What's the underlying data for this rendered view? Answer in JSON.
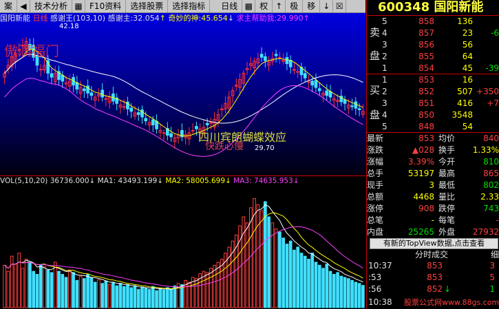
{
  "toolbar": {
    "items": [
      "案",
      "技术分析",
      "F10资料",
      "选择股票",
      "选择指标",
      "日线",
      "权",
      "极",
      "移"
    ],
    "icons": [
      "back-icon",
      "chart-icon",
      "arrow-up-icon",
      "arrow-down-icon",
      "grid-icon",
      "checkbox-icon"
    ],
    "icon_glyphs": [
      "◀",
      "▦",
      "↑",
      "↓",
      "▩",
      "☒"
    ]
  },
  "chart_header": {
    "stock_name": "国阳新能",
    "period": "日线",
    "indicator_name": "感谢王(103,10)",
    "ind1_label": "感谢主:",
    "ind1_value": "32.054",
    "ind1_arrow": "↑",
    "ind2_label": "奇妙的神:",
    "ind2_value": "45.654",
    "ind2_arrow": "↓",
    "ind3_label": "求主帮助我:",
    "ind3_value": "29.990",
    "ind3_arrow": "↑"
  },
  "annotations": {
    "peak_price": "42.18",
    "low_price": "29.70",
    "overlay_top_left": "傲满福门",
    "overlay_mid": "四川宾朗蝴蝶效应",
    "overlay_mid2": "快跌心慢"
  },
  "volume_header": {
    "label": "VOL(5,10,20)",
    "vol_value": "36736.000",
    "vol_arrow": "↓",
    "ma1": "MA1: 43493.199",
    "ma1_arrow": "↓",
    "ma2": "MA2: 58005.699",
    "ma2_arrow": "↓",
    "ma3": "MA3: 74635.953",
    "ma3_arrow": "↓"
  },
  "chart_data": [
    {
      "type": "candlestick",
      "title": "",
      "x": [
        "1",
        "2",
        "3",
        "4",
        "5",
        "6",
        "7",
        "8",
        "9",
        "10",
        "11",
        "12",
        "13",
        "14",
        "15",
        "16",
        "17",
        "18",
        "19",
        "20",
        "21",
        "22",
        "23",
        "24",
        "25",
        "26",
        "27",
        "28",
        "29",
        "30",
        "31",
        "32",
        "33",
        "34",
        "35",
        "36",
        "37",
        "38",
        "39",
        "40",
        "41",
        "42",
        "43",
        "44",
        "45",
        "46",
        "47",
        "48",
        "49",
        "50",
        "51",
        "52",
        "53",
        "54",
        "55",
        "56",
        "57",
        "58",
        "59",
        "60",
        "61",
        "62",
        "63",
        "64",
        "65",
        "66",
        "67",
        "68",
        "69",
        "70",
        "71",
        "72",
        "73",
        "74",
        "75",
        "76",
        "77",
        "78",
        "79",
        "80",
        "81",
        "82",
        "83",
        "84",
        "85",
        "86",
        "87",
        "88",
        "89",
        "90",
        "91",
        "92",
        "93",
        "94",
        "95",
        "96",
        "97",
        "98",
        "99",
        "100"
      ],
      "ylim": [
        26,
        44
      ],
      "close": [
        38,
        39,
        40,
        40.5,
        41,
        41.5,
        42,
        41,
        40,
        39,
        38.5,
        39,
        38,
        37.5,
        38,
        37.2,
        37,
        36.8,
        37,
        36.5,
        36,
        36.2,
        35.8,
        35.5,
        35.2,
        35,
        35.3,
        35,
        34.8,
        35,
        34.5,
        34.2,
        34,
        33.8,
        33.5,
        33.2,
        33,
        32.8,
        32.5,
        32,
        31.8,
        31.5,
        31,
        30.8,
        30.5,
        30.2,
        30,
        29.9,
        30.2,
        30,
        30.3,
        30.5,
        30.8,
        31,
        31,
        31.2,
        31.5,
        31.8,
        32.2,
        32.8,
        33.5,
        34.2,
        35,
        35.8,
        36.5,
        37.2,
        38,
        38.6,
        39.2,
        39.5,
        39.8,
        40,
        39.6,
        39.4,
        39.8,
        40.2,
        40,
        39.6,
        39.2,
        38.8,
        38.5,
        38.2,
        37.8,
        37.4,
        37,
        36.5,
        36.2,
        35.8,
        35.5,
        35.2,
        35,
        34.8,
        34.6,
        34.4,
        34.2,
        34,
        33.8,
        33.6,
        33.4,
        33.2
      ],
      "series": [
        {
          "name": "感谢主",
          "values": "yellow MA line"
        },
        {
          "name": "奇妙的神",
          "values": "white MA line"
        },
        {
          "name": "求主帮助我",
          "values": "magenta MA line"
        }
      ],
      "colors": {
        "up": "#ff3030",
        "down": "#40e0ff",
        "ma_yellow": "#ffff00",
        "ma_white": "#ffffff",
        "ma_magenta": "#ff40ff"
      }
    },
    {
      "type": "bar",
      "title": "",
      "ylim": [
        0,
        200000
      ],
      "values": [
        70000,
        60000,
        85000,
        72000,
        90000,
        65000,
        80000,
        75000,
        60000,
        55000,
        70000,
        68000,
        62000,
        58000,
        75000,
        60000,
        55000,
        50000,
        62000,
        58000,
        45000,
        52000,
        48000,
        55000,
        50000,
        42000,
        46000,
        40000,
        44000,
        38000,
        42000,
        36000,
        40000,
        35000,
        38000,
        33000,
        36000,
        30000,
        34000,
        32000,
        30000,
        35000,
        28000,
        31000,
        29000,
        33000,
        30000,
        36000,
        40000,
        38000,
        45000,
        42000,
        50000,
        48000,
        56000,
        60000,
        58000,
        65000,
        70000,
        75000,
        80000,
        90000,
        100000,
        110000,
        120000,
        135000,
        150000,
        140000,
        165000,
        180000,
        170000,
        160000,
        175000,
        150000,
        140000,
        130000,
        125000,
        115000,
        105000,
        110000,
        95000,
        100000,
        90000,
        85000,
        80000,
        90000,
        75000,
        70000,
        65000,
        72000,
        60000,
        55000,
        58000,
        52000,
        50000,
        48000,
        45000,
        42000,
        40000,
        36736
      ]
    }
  ],
  "panel": {
    "code": "600348",
    "name": "国阳新能",
    "sell_label_1": "卖",
    "sell_label_2": "盘",
    "buy_label_1": "买",
    "buy_label_2": "盘",
    "sells": [
      {
        "lvl": "5",
        "price": "858",
        "vol": "136",
        "chg": ""
      },
      {
        "lvl": "4",
        "price": "857",
        "vol": "23",
        "chg": "-6"
      },
      {
        "lvl": "3",
        "price": "856",
        "vol": "56",
        "chg": ""
      },
      {
        "lvl": "2",
        "price": "855",
        "vol": "64",
        "chg": ""
      },
      {
        "lvl": "1",
        "price": "854",
        "vol": "45",
        "chg": "-39"
      }
    ],
    "buys": [
      {
        "lvl": "1",
        "price": "853",
        "vol": "16",
        "chg": ""
      },
      {
        "lvl": "2",
        "price": "852",
        "vol": "507",
        "chg": "+350"
      },
      {
        "lvl": "3",
        "price": "851",
        "vol": "416",
        "chg": "+7"
      },
      {
        "lvl": "4",
        "price": "850",
        "vol": "3548",
        "chg": ""
      },
      {
        "lvl": "5",
        "price": "848",
        "vol": "54",
        "chg": ""
      }
    ],
    "stats": [
      {
        "l1": "最新",
        "v1": "853",
        "l2": "均价",
        "v2": "840"
      },
      {
        "l1": "涨跌",
        "v1": "▲028",
        "l2": "换手",
        "v2": "1.33%"
      },
      {
        "l1": "涨幅",
        "v1": "3.39%",
        "l2": "今开",
        "v2": "810"
      },
      {
        "l1": "总手",
        "v1": "53197",
        "l2": "最高",
        "v2": "865"
      },
      {
        "l1": "现手",
        "v1": "3",
        "l2": "最低",
        "v2": "802"
      },
      {
        "l1": "总额",
        "v1": "4468",
        "l2": "量比",
        "v2": "2.33"
      },
      {
        "l1": "涨停",
        "v1": "908",
        "l2": "跌停",
        "v2": "743"
      },
      {
        "l1": "总笔",
        "v1": "-",
        "l2": "每笔",
        "v2": "-"
      },
      {
        "l1": "内盘",
        "v1": "25265",
        "l2": "外盘",
        "v2": "27932"
      }
    ],
    "topview_btn": "有新的TopView数据,点击查看",
    "tab_trades": "分时成交",
    "tab_detail": "细",
    "trades": [
      {
        "time": "10:37",
        "price": "853",
        "vol": "3"
      },
      {
        "time": ":53",
        "price": "853",
        "vol": "5"
      },
      {
        "time": ":56",
        "price": "852",
        "arrow": "↓",
        "vol": "1"
      }
    ],
    "footer_time": "10:38",
    "watermark": "股票公式网www.88gs.com"
  }
}
